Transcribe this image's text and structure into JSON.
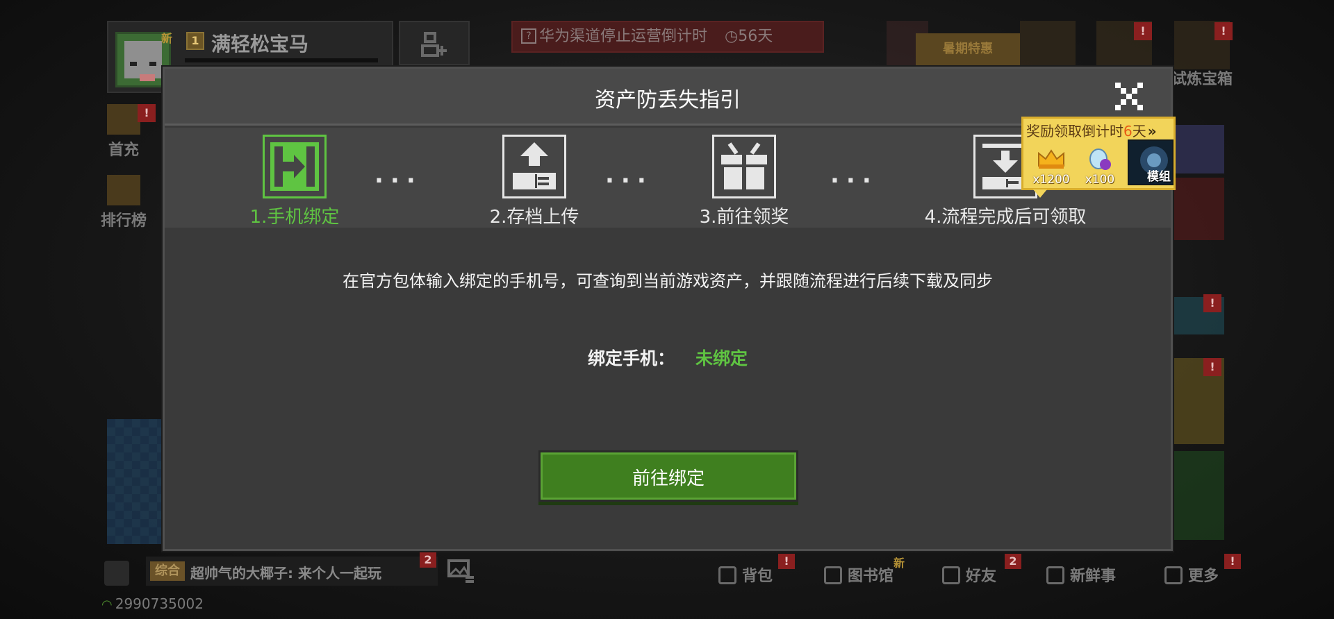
{
  "player": {
    "new_tag": "新",
    "level": "1",
    "name": "满轻松宝马"
  },
  "notice": {
    "text": "华为渠道停止运营倒计时",
    "countdown": "◷56天"
  },
  "top_right": {
    "summer_sale": "暑期特惠",
    "trial_box": "试炼宝箱",
    "badge": "!"
  },
  "left_menu": [
    {
      "label": "首充"
    },
    {
      "label": "排行榜"
    }
  ],
  "modal": {
    "title": "资产防丢失指引",
    "steps": [
      {
        "label": "1.手机绑定",
        "icon": "phone-bind-icon"
      },
      {
        "label": "2.存档上传",
        "icon": "upload-icon"
      },
      {
        "label": "3.前往领奖",
        "icon": "gift-icon"
      },
      {
        "label": "4.流程完成后可领取",
        "icon": "download-icon"
      }
    ],
    "dots": "...",
    "description": "在官方包体输入绑定的手机号，可查询到当前游戏资产，并跟随流程进行后续下载及同步",
    "bind_label": "绑定手机：",
    "bind_status": "未绑定",
    "button_label": "前往绑定",
    "colors": {
      "accent": "#5fc442",
      "button": "#3f7f1f"
    }
  },
  "reward_tip": {
    "title_prefix": "奖励领取倒计时",
    "days": "6",
    "title_suffix": "天",
    "arrows": "»",
    "items": [
      {
        "icon": "crown-icon",
        "count": "x1200"
      },
      {
        "icon": "diamond-icon",
        "count": "x100"
      }
    ],
    "mod_label": "模组"
  },
  "chat": {
    "channel": "综合",
    "message": "超帅气的大椰子: 来个人一起玩",
    "badge": "2"
  },
  "bottom_nav": [
    {
      "label": "背包",
      "badge": "!"
    },
    {
      "label": "图书馆",
      "badge": "新"
    },
    {
      "label": "好友",
      "badge": "2"
    },
    {
      "label": "新鲜事",
      "badge": ""
    },
    {
      "label": "更多",
      "badge": "!"
    }
  ],
  "status": {
    "player_id": "2990735002"
  }
}
